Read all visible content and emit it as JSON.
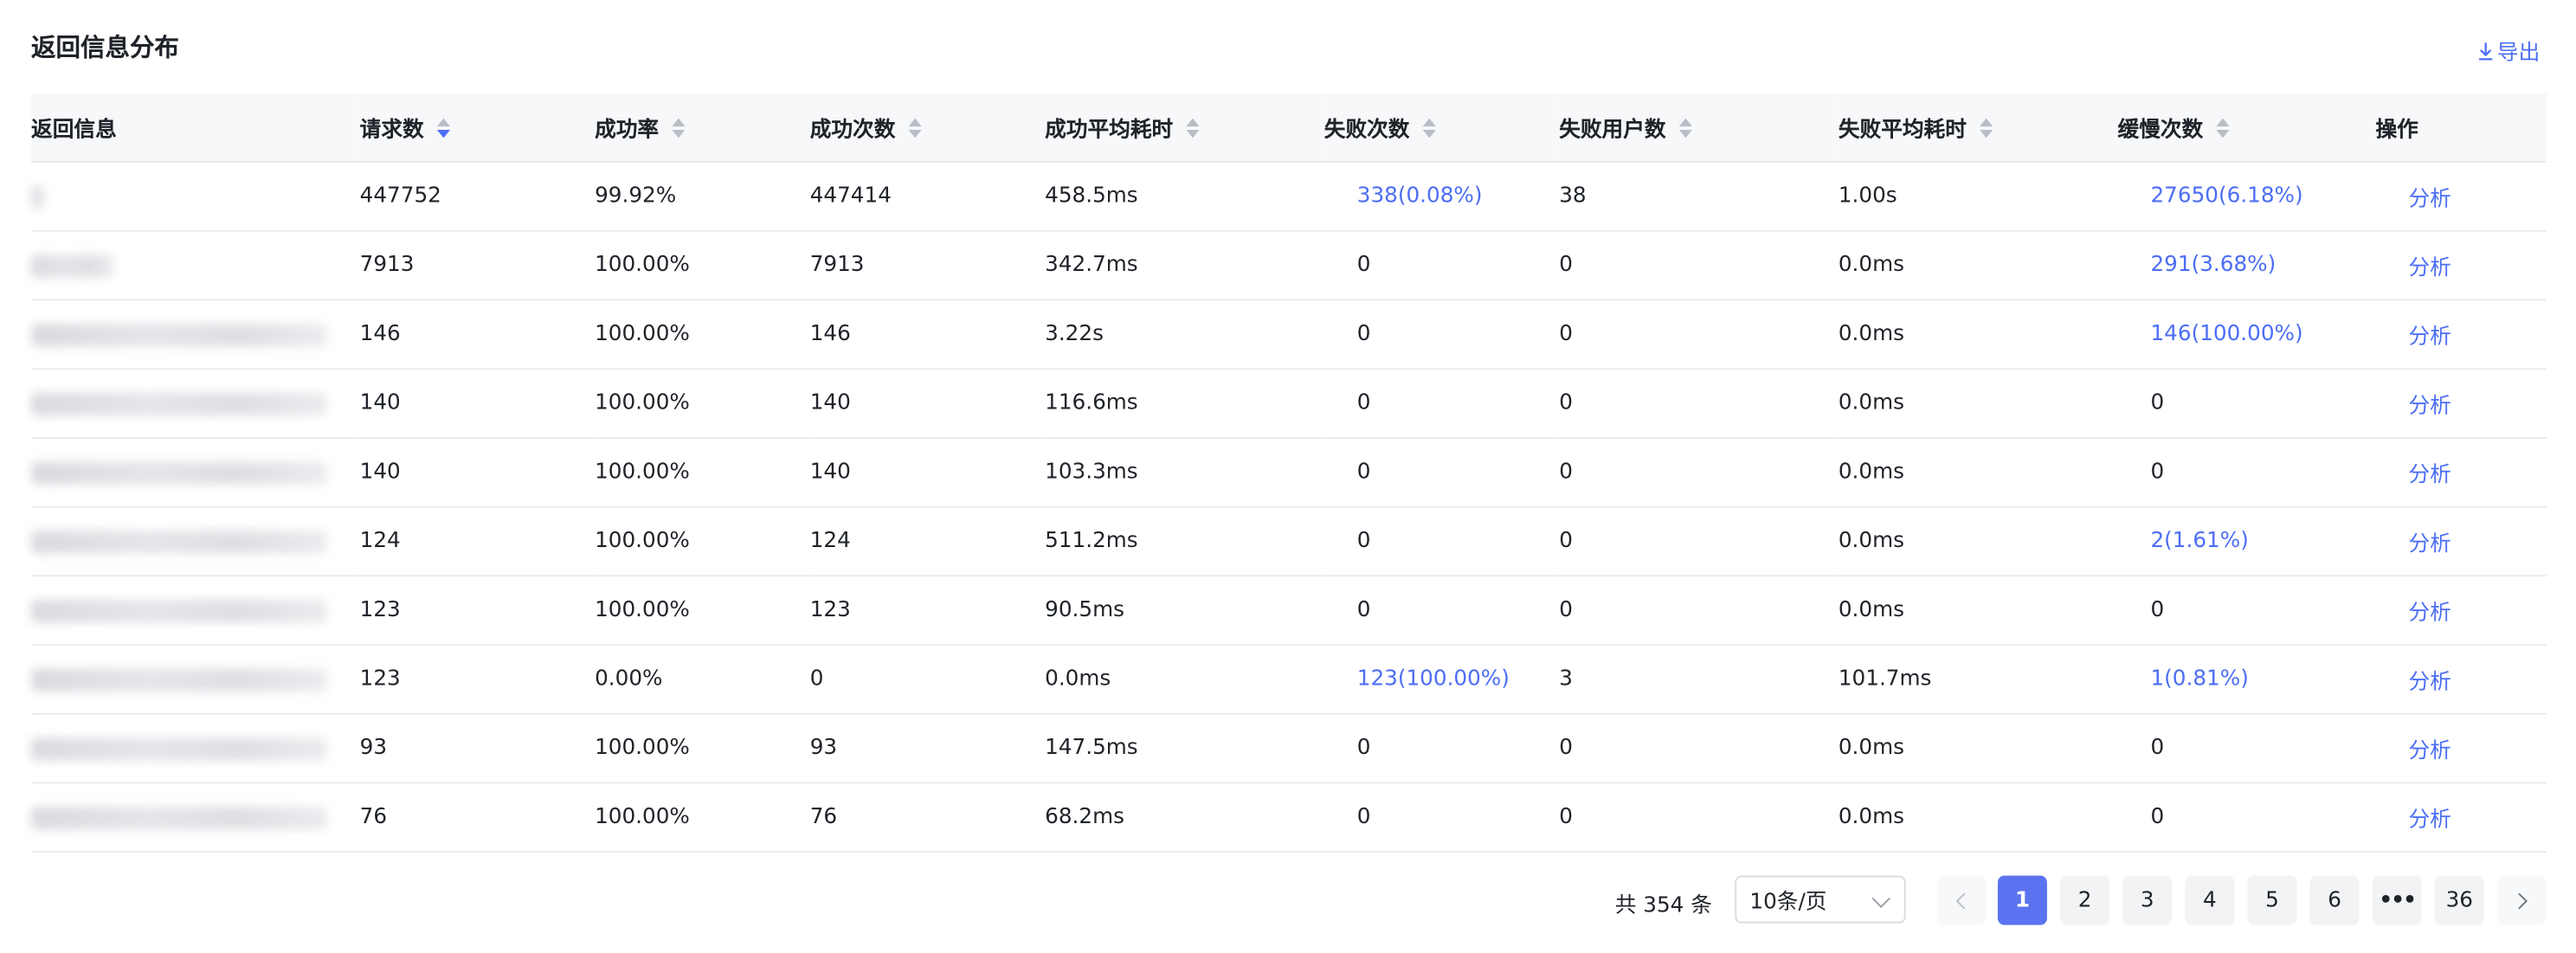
{
  "header": {
    "title": "返回信息分布",
    "export_label": "导出"
  },
  "table": {
    "columns": [
      "返回信息",
      "请求数",
      "成功率",
      "成功次数",
      "成功平均耗时",
      "失败次数",
      "失败用户数",
      "失败平均耗时",
      "缓慢次数",
      "操作"
    ],
    "rows": [
      {
        "req": "447752",
        "rate": "99.92%",
        "succ": "447414",
        "succ_avg": "458.5ms",
        "fail": "338(0.08%)",
        "fail_users": "38",
        "fail_avg": "1.00s",
        "slow": "27650(6.18%)",
        "action": "分析"
      },
      {
        "req": "7913",
        "rate": "100.00%",
        "succ": "7913",
        "succ_avg": "342.7ms",
        "fail": "0",
        "fail_users": "0",
        "fail_avg": "0.0ms",
        "slow": "291(3.68%)",
        "action": "分析"
      },
      {
        "req": "146",
        "rate": "100.00%",
        "succ": "146",
        "succ_avg": "3.22s",
        "fail": "0",
        "fail_users": "0",
        "fail_avg": "0.0ms",
        "slow": "146(100.00%)",
        "action": "分析"
      },
      {
        "req": "140",
        "rate": "100.00%",
        "succ": "140",
        "succ_avg": "116.6ms",
        "fail": "0",
        "fail_users": "0",
        "fail_avg": "0.0ms",
        "slow": "0",
        "action": "分析"
      },
      {
        "req": "140",
        "rate": "100.00%",
        "succ": "140",
        "succ_avg": "103.3ms",
        "fail": "0",
        "fail_users": "0",
        "fail_avg": "0.0ms",
        "slow": "0",
        "action": "分析"
      },
      {
        "req": "124",
        "rate": "100.00%",
        "succ": "124",
        "succ_avg": "511.2ms",
        "fail": "0",
        "fail_users": "0",
        "fail_avg": "0.0ms",
        "slow": "2(1.61%)",
        "action": "分析"
      },
      {
        "req": "123",
        "rate": "100.00%",
        "succ": "123",
        "succ_avg": "90.5ms",
        "fail": "0",
        "fail_users": "0",
        "fail_avg": "0.0ms",
        "slow": "0",
        "action": "分析"
      },
      {
        "req": "123",
        "rate": "0.00%",
        "succ": "0",
        "succ_avg": "0.0ms",
        "fail": "123(100.00%)",
        "fail_users": "3",
        "fail_avg": "101.7ms",
        "slow": "1(0.81%)",
        "action": "分析"
      },
      {
        "req": "93",
        "rate": "100.00%",
        "succ": "93",
        "succ_avg": "147.5ms",
        "fail": "0",
        "fail_users": "0",
        "fail_avg": "0.0ms",
        "slow": "0",
        "action": "分析"
      },
      {
        "req": "76",
        "rate": "100.00%",
        "succ": "76",
        "succ_avg": "68.2ms",
        "fail": "0",
        "fail_users": "0",
        "fail_avg": "0.0ms",
        "slow": "0",
        "action": "分析"
      }
    ]
  },
  "pagination": {
    "total_text": "共 354 条",
    "page_size": "10条/页",
    "pages": [
      "1",
      "2",
      "3",
      "4",
      "5",
      "6",
      "•••",
      "36"
    ],
    "current": "1"
  },
  "colors": {
    "accent": "#4c6ef5",
    "active_page": "#5b73f0",
    "header_bg": "#f7f8fa"
  },
  "icons": [
    "download-icon",
    "sort-icon",
    "chevron-down-icon",
    "chevron-left-icon",
    "chevron-right-icon"
  ]
}
